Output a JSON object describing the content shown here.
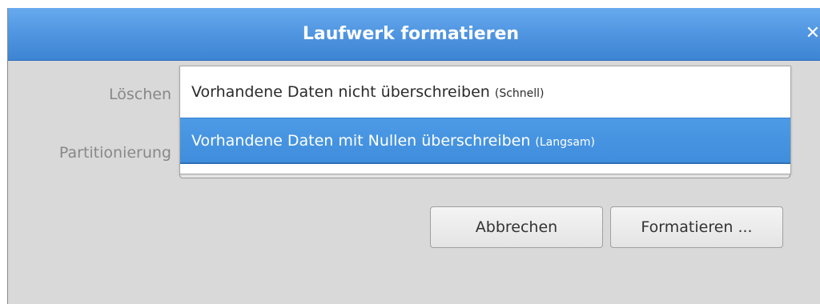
{
  "dialog": {
    "title": "Laufwerk formatieren",
    "close_symbol": "✕"
  },
  "form": {
    "erase_label": "Löschen",
    "partitioning_label": "Partitionierung"
  },
  "erase_dropdown": {
    "options": [
      {
        "text": "Vorhandene Daten nicht überschreiben",
        "note": "(Schnell)",
        "highlighted": false
      },
      {
        "text": "Vorhandene Daten mit Nullen überschreiben",
        "note": "(Langsam)",
        "highlighted": true
      }
    ]
  },
  "buttons": {
    "cancel": "Abbrechen",
    "format": "Formatieren ..."
  },
  "colors": {
    "titlebar": "#4f95e0",
    "highlight": "#3f8ddc",
    "window_bg": "#d9d9d9"
  }
}
